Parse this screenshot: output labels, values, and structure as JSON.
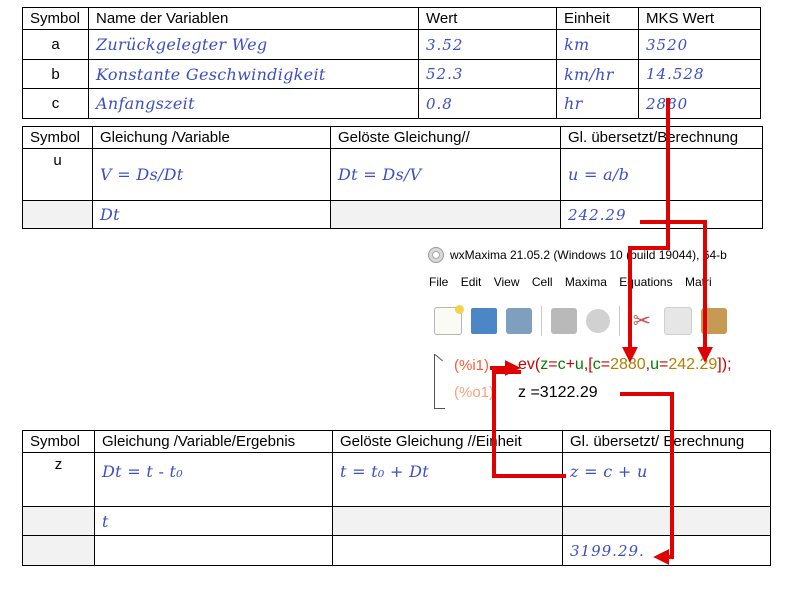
{
  "table1": {
    "headers": [
      "Symbol",
      "Name der Variablen",
      "Wert",
      "Einheit",
      "MKS Wert"
    ],
    "rows": [
      {
        "symbol": "a",
        "name": "Zurückgelegter Weg",
        "wert": "3.52",
        "einheit": "km",
        "mks": "3520"
      },
      {
        "symbol": "b",
        "name": "Konstante Geschwindigkeit",
        "wert": "52.3",
        "einheit": "km/hr",
        "mks": "14.528"
      },
      {
        "symbol": "c",
        "name": "Anfangszeit",
        "wert": "0.8",
        "einheit": "hr",
        "mks": "2880"
      }
    ]
  },
  "table2": {
    "headers": [
      "Symbol",
      "Gleichung /Variable",
      "Gelöste Gleichung//",
      "Gl. übersetzt/Berechnung"
    ],
    "row1": {
      "symbol": "u",
      "gleichung": "V = Ds/Dt",
      "geloest": "Dt = Ds/V",
      "berechnung": "u = a/b"
    },
    "row2": {
      "symbol": "",
      "gleichung": "Dt",
      "geloest": "",
      "berechnung": "242.29"
    }
  },
  "wxmaxima": {
    "title": "wxMaxima 21.05.2 (Windows 10 (build 19044), 64-b",
    "menu": [
      "File",
      "Edit",
      "View",
      "Cell",
      "Maxima",
      "Equations",
      "Matri"
    ],
    "toolbar_icons": [
      "new-file-icon",
      "open-folder-icon",
      "save-icon",
      "print-icon",
      "settings-icon",
      "cut-icon",
      "copy-icon",
      "paste-icon"
    ],
    "input_label": "(%i1)",
    "output_label": "(%o1)",
    "input_parts": {
      "fn_open": "ev(",
      "z": "z",
      "eq1": "=",
      "c1": "c",
      "plus": "+",
      "u1": "u",
      "comma1": ",[",
      "c2": "c",
      "eq2": "=",
      "cval": "2880",
      "comma2": ",",
      "u2": "u",
      "eq3": "=",
      "uval": "242.29",
      "close": "]);"
    },
    "output_expr": "z =3122.29"
  },
  "table3": {
    "headers": [
      "Symbol",
      "Gleichung /Variable/Ergebnis",
      "Gelöste Gleichung //Einheit",
      "Gl. übersetzt/ Berechnung"
    ],
    "row1": {
      "symbol": "z",
      "gleichung": "Dt = t - t₀",
      "geloest": "t = t₀ + Dt",
      "berechnung": "z = c + u"
    },
    "row2": {
      "symbol": "",
      "gleichung": "t",
      "geloest": "",
      "berechnung": ""
    },
    "row3": {
      "symbol": "",
      "gleichung": "",
      "geloest": "",
      "berechnung": "3199.29."
    }
  },
  "colors": {
    "handwriting": "#3b4ec8",
    "arrow": "#e00000",
    "shaded": "#f2f2f2"
  }
}
